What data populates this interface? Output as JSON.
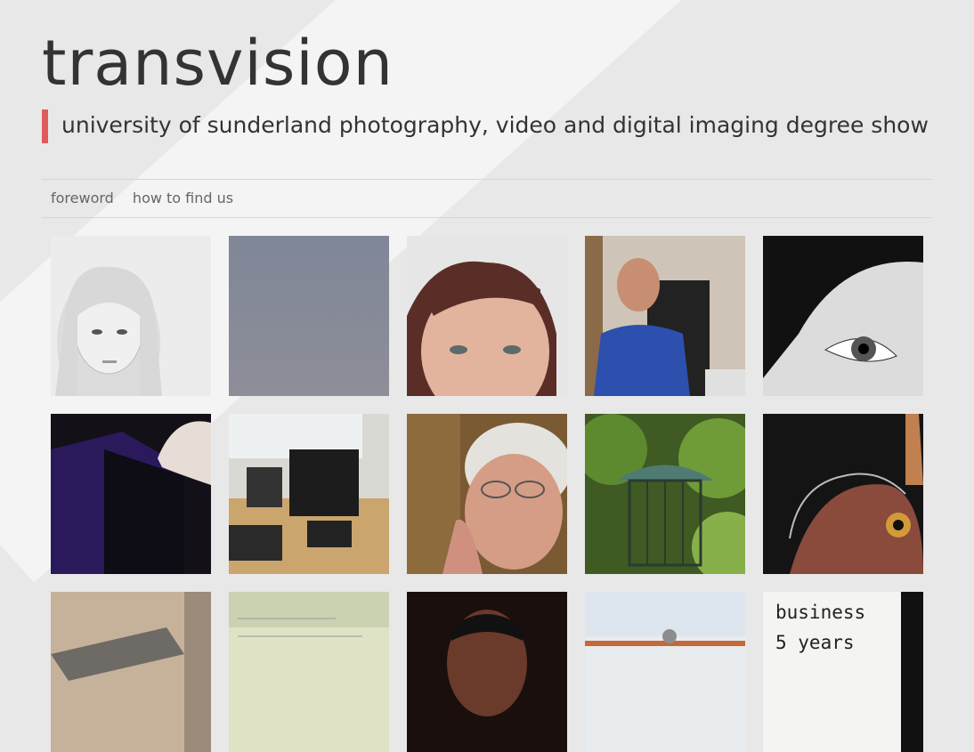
{
  "site": {
    "title": "transvision",
    "subtitle": "university of sunderland photography, video and digital imaging degree show"
  },
  "nav": {
    "items": [
      {
        "label": "foreword"
      },
      {
        "label": "how to find us"
      }
    ]
  },
  "thumbnails": [
    {
      "depicts": "blonde-wig-portrait"
    },
    {
      "depicts": "grey-sky"
    },
    {
      "depicts": "woman-close-up-face"
    },
    {
      "depicts": "man-in-office-chair"
    },
    {
      "depicts": "eye-close-up"
    },
    {
      "depicts": "hand-on-speaker"
    },
    {
      "depicts": "computer-room"
    },
    {
      "depicts": "elderly-woman"
    },
    {
      "depicts": "bird-feeder"
    },
    {
      "depicts": "fish-head"
    },
    {
      "depicts": "metal-object"
    },
    {
      "depicts": "papers"
    },
    {
      "depicts": "man-dark-portrait"
    },
    {
      "depicts": "sky-with-tree"
    },
    {
      "depicts": "handwritten-sign",
      "text": "business\n5 years"
    }
  ],
  "colors": {
    "background": "#e8e8e8",
    "accent": "#e05a5a",
    "text": "#333333",
    "nav_text": "#666666"
  }
}
